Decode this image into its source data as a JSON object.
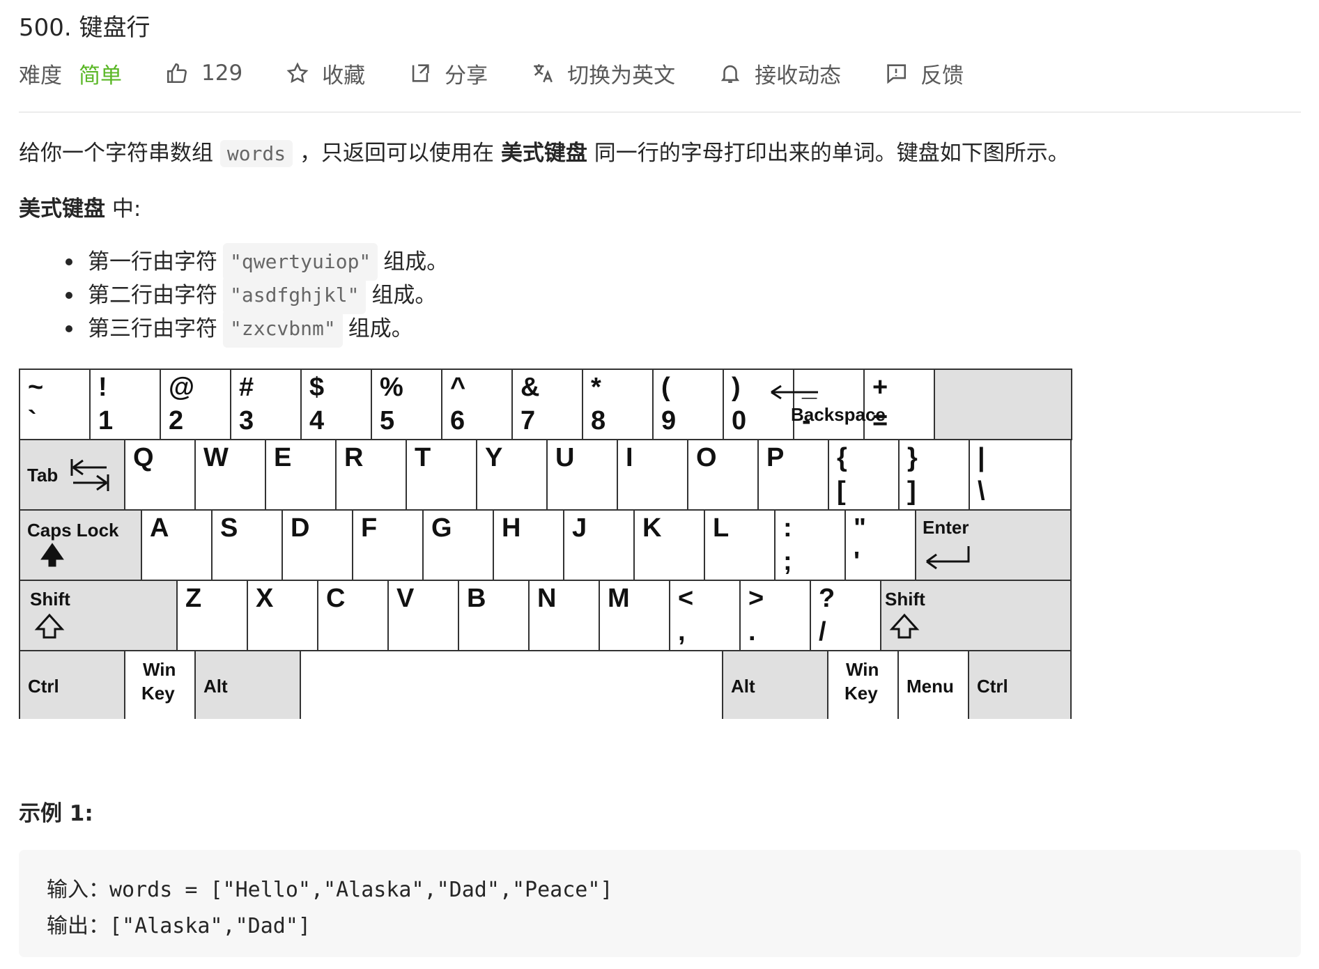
{
  "problem": {
    "title": "500. 键盘行"
  },
  "meta": {
    "difficulty_label": "难度",
    "difficulty_value": "简单",
    "likes": "129",
    "favorite": "收藏",
    "share": "分享",
    "switch_lang": "切换为英文",
    "subscribe": "接收动态",
    "feedback": "反馈",
    "colors": {
      "easy": "#5ab726",
      "text": "#262626",
      "muted": "#595959"
    }
  },
  "description": {
    "p1_a": "给你一个字符串数组",
    "p1_code": "words",
    "p1_b": "，只返回可以使用在",
    "p1_bold": "美式键盘",
    "p1_c": "同一行的字母打印出来的单词。键盘如下图所示。",
    "p2_bold": "美式键盘",
    "p2_rest": "中:",
    "rows": [
      {
        "prefix": "第一行由字符",
        "code": "\"qwertyuiop\"",
        "suffix": "组成。"
      },
      {
        "prefix": "第二行由字符",
        "code": "\"asdfghjkl\"",
        "suffix": "组成。"
      },
      {
        "prefix": "第三行由字符",
        "code": "\"zxcvbnm\"",
        "suffix": "组成。"
      }
    ]
  },
  "keyboard": {
    "row1": [
      {
        "top": "~",
        "bot": "`"
      },
      {
        "top": "!",
        "bot": "1"
      },
      {
        "top": "@",
        "bot": "2"
      },
      {
        "top": "#",
        "bot": "3"
      },
      {
        "top": "$",
        "bot": "4"
      },
      {
        "top": "%",
        "bot": "5"
      },
      {
        "top": "^",
        "bot": "6"
      },
      {
        "top": "&",
        "bot": "7"
      },
      {
        "top": "*",
        "bot": "8"
      },
      {
        "top": "(",
        "bot": "9"
      },
      {
        "top": ")",
        "bot": "0"
      },
      {
        "top": "_",
        "bot": "-"
      },
      {
        "top": "+",
        "bot": "="
      }
    ],
    "backspace": "Backspace",
    "tab": "Tab",
    "row2": [
      "Q",
      "W",
      "E",
      "R",
      "T",
      "Y",
      "U",
      "I",
      "O",
      "P"
    ],
    "row2_sym": [
      {
        "top": "{",
        "bot": "["
      },
      {
        "top": "}",
        "bot": "]"
      },
      {
        "top": "|",
        "bot": "\\"
      }
    ],
    "caps": "Caps Lock",
    "row3": [
      "A",
      "S",
      "D",
      "F",
      "G",
      "H",
      "J",
      "K",
      "L"
    ],
    "row3_sym": [
      {
        "top": ":",
        "bot": ";"
      },
      {
        "top": "\"",
        "bot": "'"
      }
    ],
    "enter": "Enter",
    "shift": "Shift",
    "row4": [
      "Z",
      "X",
      "C",
      "V",
      "B",
      "N",
      "M"
    ],
    "row4_sym": [
      {
        "top": "<",
        "bot": ","
      },
      {
        "top": ">",
        "bot": "."
      },
      {
        "top": "?",
        "bot": "/"
      }
    ],
    "ctrl": "Ctrl",
    "win_top": "Win",
    "win_bot": "Key",
    "alt": "Alt",
    "menu": "Menu",
    "colors": {
      "grey_key": "#e0e0e0",
      "white_key": "#ffffff",
      "border": "#333333"
    }
  },
  "example": {
    "title": "示例 1:",
    "input": "输入：words = [\"Hello\",\"Alaska\",\"Dad\",\"Peace\"]",
    "output": "输出：[\"Alaska\",\"Dad\"]"
  }
}
